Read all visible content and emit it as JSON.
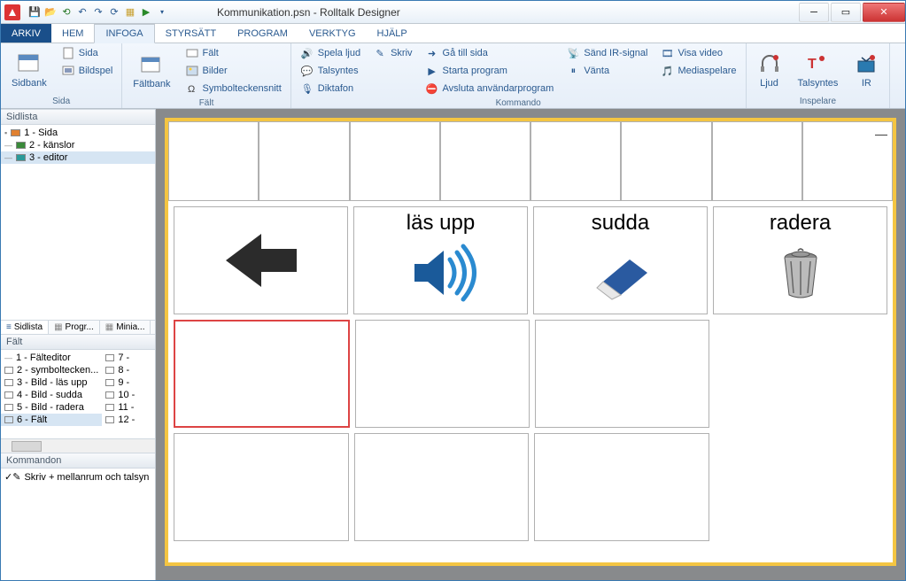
{
  "app": {
    "title": "Kommunikation.psn - Rolltalk Designer"
  },
  "tabs": {
    "file": "ARKIV",
    "items": [
      "HEM",
      "INFOGA",
      "STYRSÄTT",
      "PROGRAM",
      "VERKTYG",
      "HJÄLP"
    ],
    "active": "INFOGA"
  },
  "ribbon": {
    "sida": {
      "label": "Sida",
      "sidbank": "Sidbank",
      "sida": "Sida",
      "bildspel": "Bildspel"
    },
    "falt": {
      "label": "Fält",
      "faltbank": "Fältbank",
      "falt": "Fält",
      "bilder": "Bilder",
      "symbol": "Symbolteckensnitt"
    },
    "kommando": {
      "label": "Kommando",
      "spela_ljud": "Spela ljud",
      "talsyntes": "Talsyntes",
      "diktafon": "Diktafon",
      "skriv": "Skriv",
      "ga_till_sida": "Gå till sida",
      "starta_program": "Starta program",
      "avsluta": "Avsluta användarprogram",
      "sand_ir": "Sänd IR-signal",
      "vanta": "Vänta",
      "visa_video": "Visa video",
      "mediaspelare": "Mediaspelare"
    },
    "inspelare": {
      "label": "Inspelare",
      "ljud": "Ljud",
      "talsyntes": "Talsyntes",
      "ir": "IR"
    }
  },
  "sidlista": {
    "title": "Sidlista",
    "items": [
      {
        "label": "1 - Sida",
        "color": "orange"
      },
      {
        "label": "2 - känslor",
        "color": "green"
      },
      {
        "label": "3 - editor",
        "color": "teal",
        "selected": true
      }
    ],
    "tabs": {
      "sidlista": "Sidlista",
      "program": "Progr...",
      "miniat": "Minia..."
    }
  },
  "falt_panel": {
    "title": "Fält",
    "col1": [
      "1 - Fälteditor",
      "2 - symboltecken...",
      "3 - Bild - läs upp",
      "4 - Bild - sudda",
      "5 - Bild - radera",
      "6 - Fält"
    ],
    "col2": [
      "7 - ",
      "8 - ",
      "9 - ",
      "10 - ",
      "11 - ",
      "12 - "
    ],
    "selected": "6 - Fält"
  },
  "kommandon": {
    "title": "Kommandon",
    "items": [
      "Skriv + mellanrum och talsyn"
    ]
  },
  "canvas": {
    "cells": {
      "las_upp": "läs upp",
      "sudda": "sudda",
      "radera": "radera"
    }
  }
}
